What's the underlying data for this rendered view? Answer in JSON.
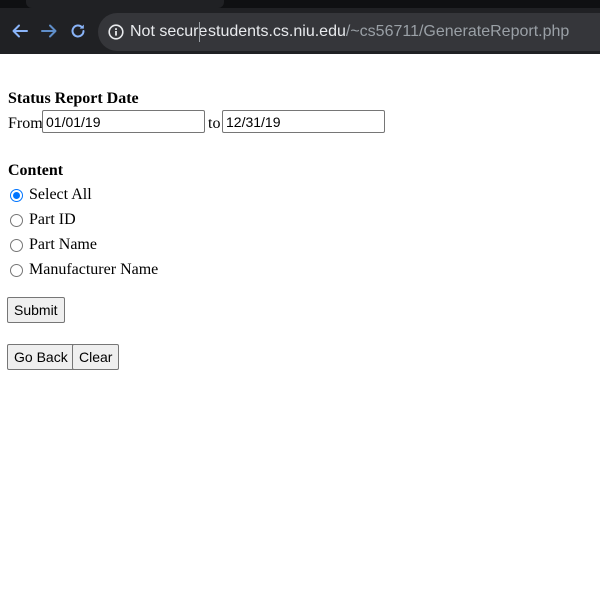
{
  "browser": {
    "security_label": "Not secure",
    "url_host": "students.cs.niu.edu",
    "url_path": "/~cs56711/GenerateReport.php",
    "icons": {
      "back": "back-arrow-icon",
      "forward": "forward-arrow-icon",
      "reload": "reload-icon",
      "info": "info-icon"
    },
    "colors": {
      "toolbar": "#202124",
      "omnibox": "#35363a",
      "nav_icon": "#8ab4f8"
    }
  },
  "form": {
    "date_section_title": "Status Report Date",
    "from_label": "From",
    "from_value": "01/01/19",
    "to_label": "to",
    "to_value": "12/31/19",
    "content_title": "Content",
    "options": [
      {
        "label": "Select All",
        "checked": true
      },
      {
        "label": "Part ID",
        "checked": false
      },
      {
        "label": "Part Name",
        "checked": false
      },
      {
        "label": "Manufacturer Name",
        "checked": false
      }
    ],
    "submit_label": "Submit",
    "go_back_label": "Go Back",
    "clear_label": "Clear",
    "accent_color": "#0075ff"
  }
}
